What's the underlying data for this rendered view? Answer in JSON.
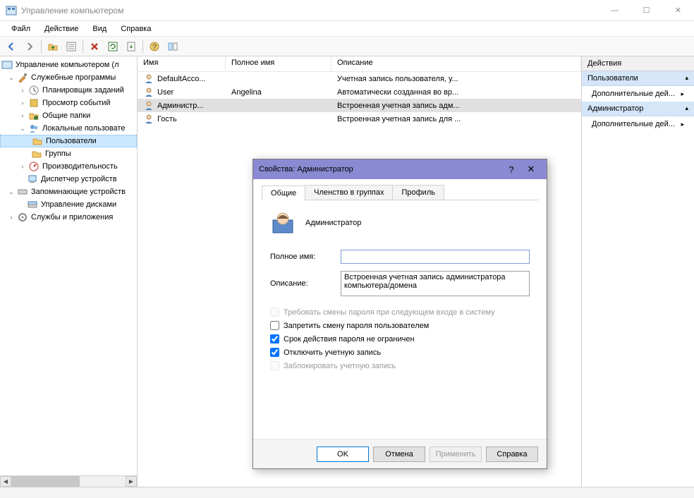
{
  "window": {
    "title": "Управление компьютером"
  },
  "win_controls": {
    "min": "—",
    "max": "☐",
    "close": "✕"
  },
  "menu": [
    "Файл",
    "Действие",
    "Вид",
    "Справка"
  ],
  "tree": {
    "root": "Управление компьютером (л",
    "sys_tools": "Служебные программы",
    "scheduler": "Планировщик заданий",
    "eventvwr": "Просмотр событий",
    "shared": "Общие папки",
    "local_users": "Локальные пользовате",
    "users": "Пользователи",
    "groups": "Группы",
    "perf": "Производительность",
    "devmgr": "Диспетчер устройств",
    "storage": "Запоминающие устройств",
    "diskmgmt": "Управление дисками",
    "services": "Службы и приложения"
  },
  "list": {
    "columns": {
      "name": "Имя",
      "fullname": "Полное имя",
      "desc": "Описание"
    },
    "rows": [
      {
        "name": "DefaultAcco...",
        "fullname": "",
        "desc": "Учетная запись пользователя, у..."
      },
      {
        "name": "User",
        "fullname": "Angelina",
        "desc": "Автоматически созданная во вр..."
      },
      {
        "name": "Администр...",
        "fullname": "",
        "desc": "Встроенная учетная запись адм...",
        "selected": true
      },
      {
        "name": "Гость",
        "fullname": "",
        "desc": "Встроенная учетная запись для ..."
      }
    ]
  },
  "actions": {
    "header": "Действия",
    "sections": [
      {
        "title": "Пользователи",
        "links": [
          {
            "label": "Дополнительные дей..."
          }
        ]
      },
      {
        "title": "Администратор",
        "links": [
          {
            "label": "Дополнительные дей..."
          }
        ]
      }
    ]
  },
  "dialog": {
    "title": "Свойства: Администратор",
    "help": "?",
    "close": "✕",
    "tabs": {
      "general": "Общие",
      "membership": "Членство в группах",
      "profile": "Профиль"
    },
    "username": "Администратор",
    "fields": {
      "fullname_label": "Полное имя:",
      "fullname_value": "",
      "desc_label": "Описание:",
      "desc_value": "Встроенная учетная запись администратора компьютера/домена"
    },
    "checks": {
      "must_change": "Требовать смены пароля при следующем входе в систему",
      "cannot_change": "Запретить смену пароля пользователем",
      "never_expires": "Срок действия пароля не ограничен",
      "disabled": "Отключить учетную запись",
      "locked": "Заблокировать учетную запись"
    },
    "buttons": {
      "ok": "OK",
      "cancel": "Отмена",
      "apply": "Применить",
      "help": "Справка"
    }
  }
}
